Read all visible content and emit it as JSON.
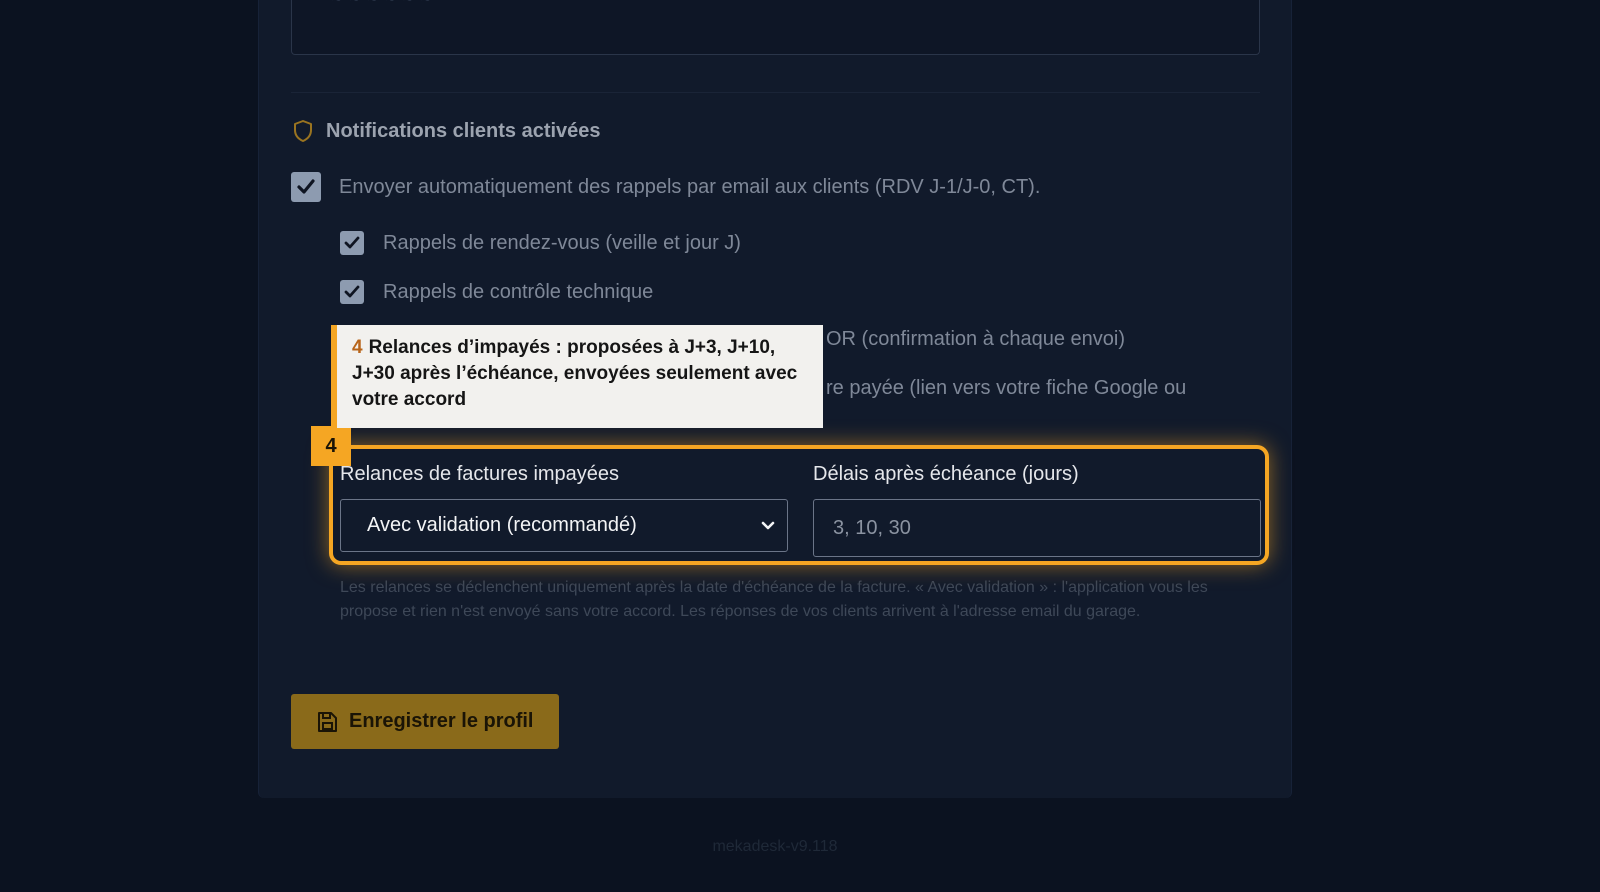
{
  "section": {
    "title": "Notifications clients activées",
    "icon": "shield-icon"
  },
  "checkboxes": {
    "main": {
      "label": "Envoyer automatiquement des rappels par email aux clients (RDV J-1/J-0, CT).",
      "checked": true
    },
    "appointments": {
      "label": "Rappels de rendez-vous (veille et jour J)",
      "checked": true
    },
    "inspection": {
      "label": "Rappels de contrôle technique",
      "checked": true
    },
    "partial_3": "OR (confirmation à chaque envoi)",
    "partial_4": "re payée (lien vers votre fiche Google ou"
  },
  "reminders": {
    "select_label": "Relances de factures impayées",
    "select_value": "Avec validation (recommandé)",
    "delay_label": "Délais après échéance (jours)",
    "delay_placeholder": "3, 10, 30"
  },
  "hint": "Les relances se déclenchent uniquement après la date d'échéance de la facture. « Avec validation » : l'application vous les propose et rien n'est envoyé sans votre accord. Les réponses de vos clients arrivent à l'adresse email du garage.",
  "save_button": {
    "label": "Enregistrer le profil",
    "icon": "save-icon"
  },
  "version": "mekadesk-v9.118",
  "tour": {
    "step_number": "4",
    "tooltip_number": "4",
    "tooltip_text": "Relances d’impayés : proposées à J+3, J+10, J+30 après l’échéance, envoyées seulement avec votre accord"
  },
  "colors": {
    "accent": "#f5a623",
    "background": "#0b1220",
    "card": "#111a2b"
  }
}
